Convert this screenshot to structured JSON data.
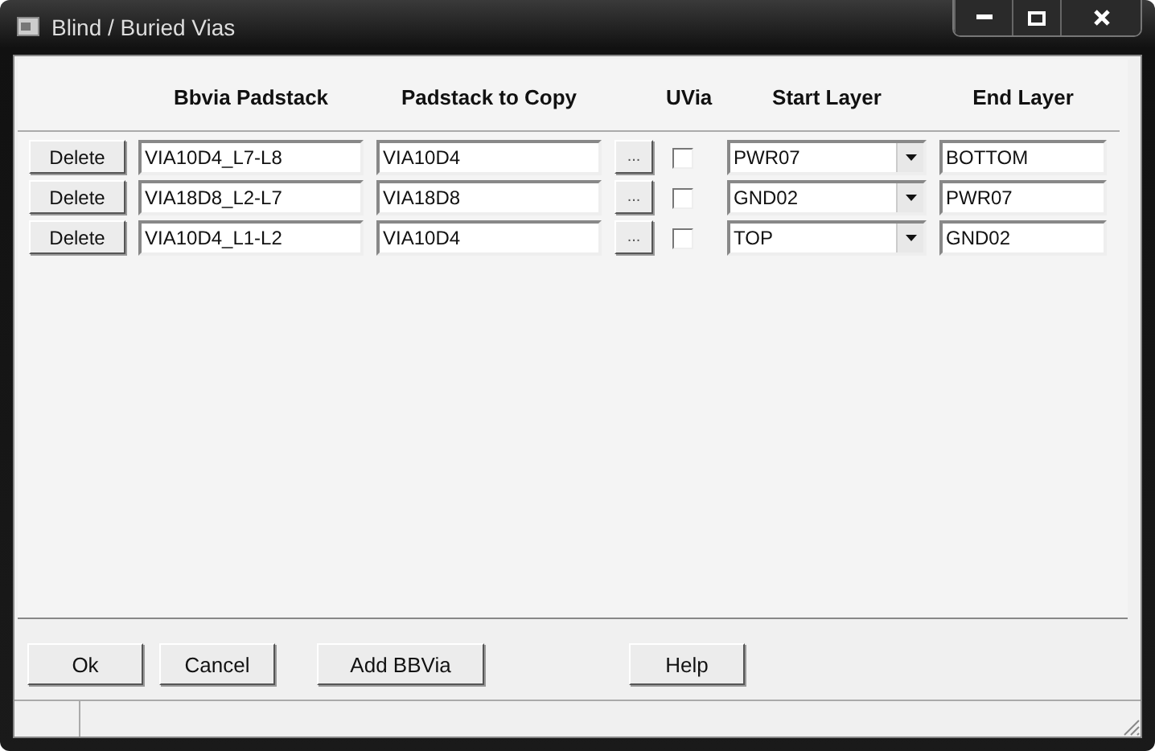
{
  "window": {
    "title": "Blind / Buried Vias"
  },
  "columns": [
    "Bbvia Padstack",
    "Padstack to Copy",
    "UVia",
    "Start Layer",
    "End Layer"
  ],
  "rows": [
    {
      "delete": "Delete",
      "bbvia": "VIA10D4_L7-L8",
      "copy": "VIA10D4",
      "browse": "...",
      "uvia": false,
      "start": "PWR07",
      "end": "BOTTOM"
    },
    {
      "delete": "Delete",
      "bbvia": "VIA18D8_L2-L7",
      "copy": "VIA18D8",
      "browse": "...",
      "uvia": false,
      "start": "GND02",
      "end": "PWR07"
    },
    {
      "delete": "Delete",
      "bbvia": "VIA10D4_L1-L2",
      "copy": "VIA10D4",
      "browse": "...",
      "uvia": false,
      "start": "TOP",
      "end": "GND02"
    }
  ],
  "buttons": [
    "Ok",
    "Cancel",
    "Add BBVia",
    "Help"
  ]
}
